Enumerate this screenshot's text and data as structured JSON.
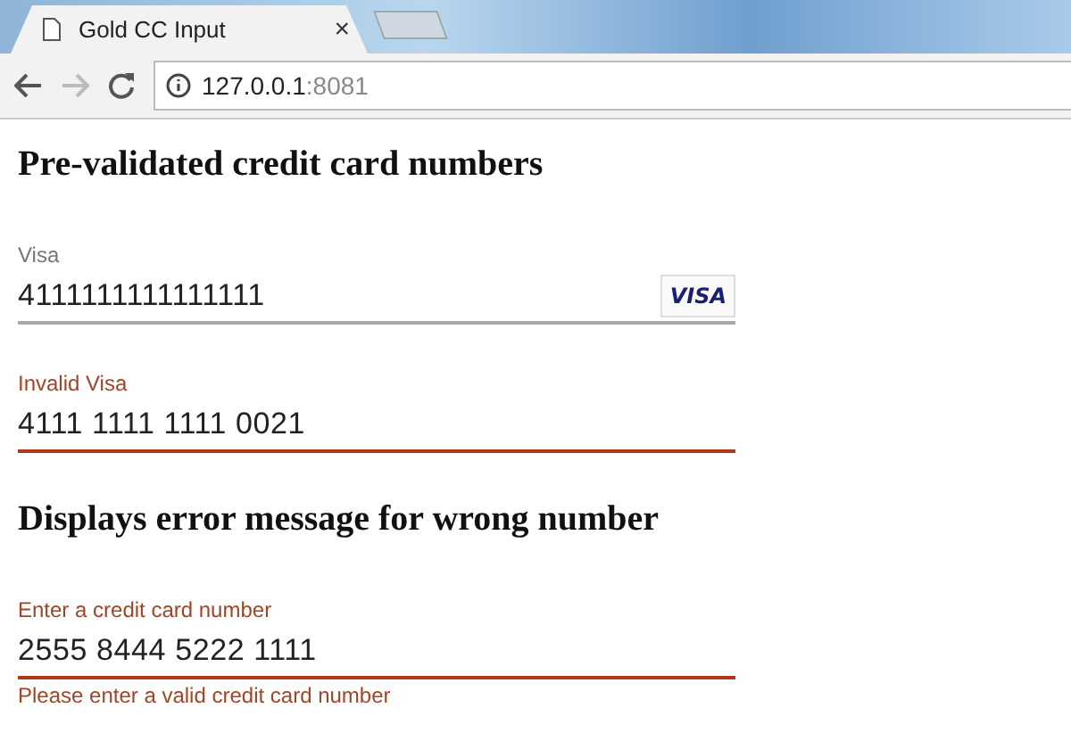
{
  "browser": {
    "tab_title": "Gold CC Input",
    "tab_close": "×",
    "url_host": "127.0.0.1",
    "url_port": ":8081"
  },
  "sections": [
    {
      "heading": "Pre-validated credit card numbers",
      "fields": [
        {
          "label": "Visa",
          "value": "4111111111111111",
          "invalid": false,
          "card_logo": "VISA"
        },
        {
          "label": "Invalid Visa",
          "value": "4111 1111 1111 0021",
          "invalid": true
        }
      ]
    },
    {
      "heading": "Displays error message for wrong number",
      "fields": [
        {
          "label": "Enter a credit card number",
          "value": "2555 8444 5222 1111",
          "invalid": true,
          "error": "Please enter a valid credit card number"
        }
      ]
    }
  ]
}
